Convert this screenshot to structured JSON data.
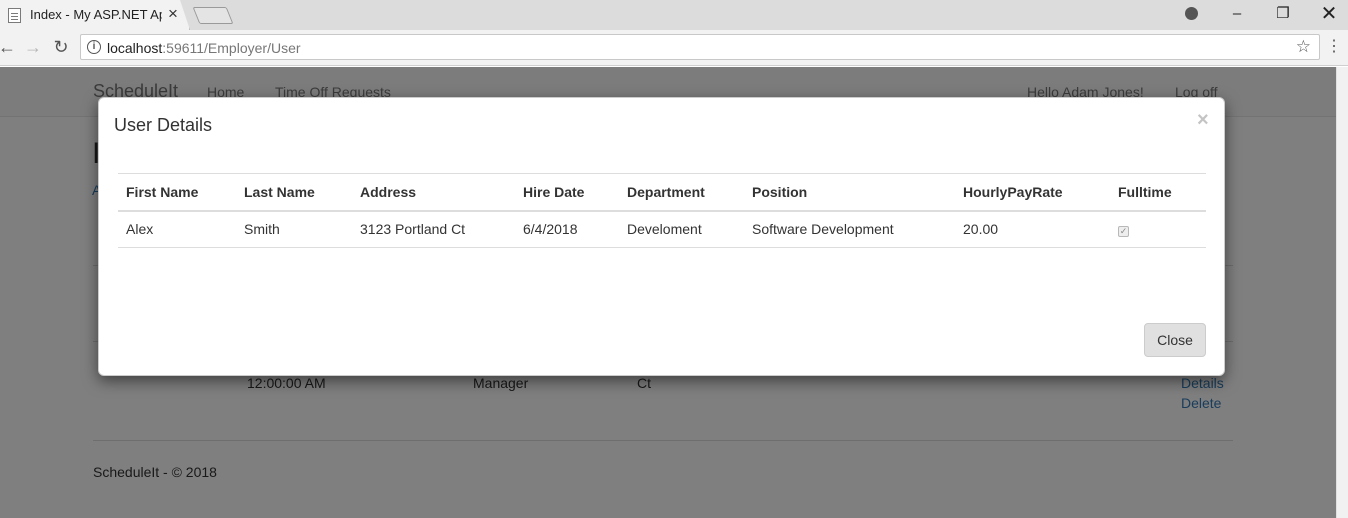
{
  "browser": {
    "tab_title": "Index - My ASP.NET Appl",
    "url_host": "localhost",
    "url_path": ":59611/Employer/User"
  },
  "icons": {
    "tab_close": "×",
    "back": "←",
    "forward": "→",
    "reload": "↻",
    "info": "i",
    "star": "☆",
    "menu": "⋮",
    "minimize": "–",
    "maximize": "❐",
    "close": "✕",
    "modal_close": "×",
    "checkmark": "✓"
  },
  "navbar": {
    "brand": "ScheduleIt",
    "home": "Home",
    "time_off": "Time Off Requests",
    "hello": "Hello Adam Jones!",
    "log_off": "Log off"
  },
  "background": {
    "heading_initial": "I",
    "subtext_initial": "A",
    "row": {
      "time": "12:00:00 AM",
      "position": "Manager",
      "address_tail": "Ct"
    },
    "details_link": "Details",
    "delete_link": "Delete",
    "footer": "ScheduleIt - © 2018"
  },
  "modal": {
    "title": "User Details",
    "columns": [
      "First Name",
      "Last Name",
      "Address",
      "Hire Date",
      "Department",
      "Position",
      "HourlyPayRate",
      "Fulltime"
    ],
    "rows": [
      {
        "first_name": "Alex",
        "last_name": "Smith",
        "address": "3123 Portland Ct",
        "hire_date": "6/4/2018",
        "department": "Develoment",
        "position": "Software Development",
        "hourly_pay_rate": "20.00",
        "fulltime": true
      }
    ],
    "close_label": "Close"
  }
}
